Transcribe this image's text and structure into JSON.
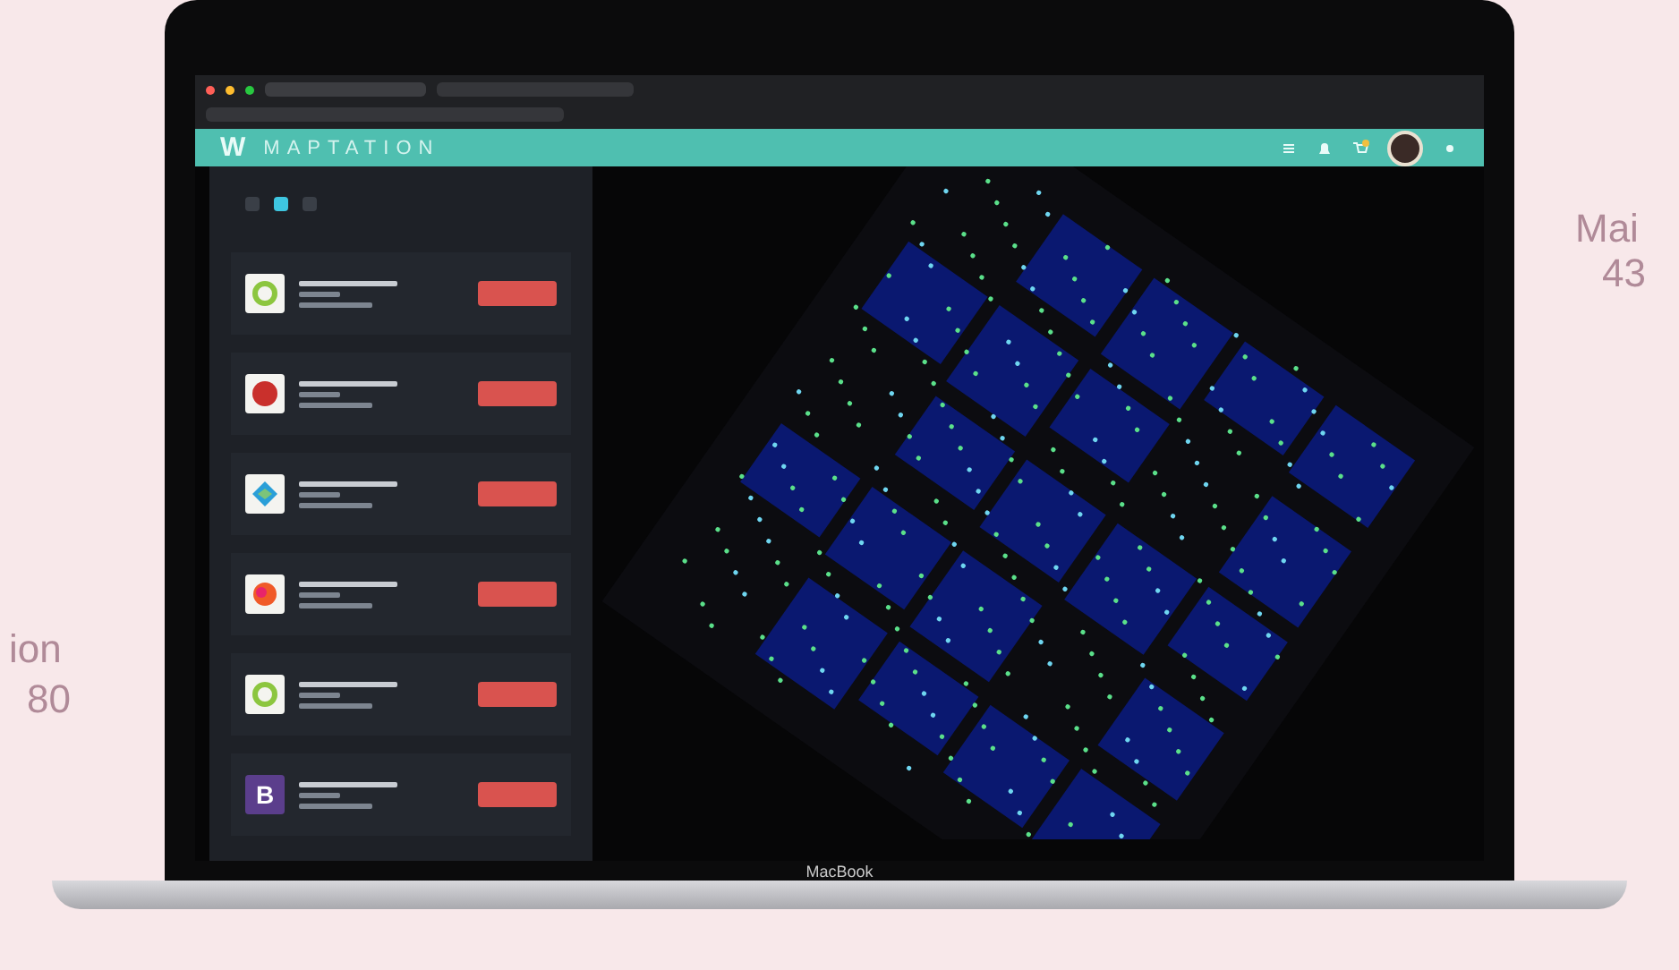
{
  "background_texts": [
    "Mai",
    "43",
    "ion",
    "80"
  ],
  "header": {
    "logo": "W",
    "brand": "MAPTATION"
  },
  "pages": [
    {
      "selected": false
    },
    {
      "selected": true
    },
    {
      "selected": false
    }
  ],
  "items": [
    {
      "kind": "ring"
    },
    {
      "kind": "red"
    },
    {
      "kind": "diamond"
    },
    {
      "kind": "orange"
    },
    {
      "kind": "ring"
    },
    {
      "kind": "letter",
      "letter": "B"
    }
  ],
  "device_label": "MacBook"
}
